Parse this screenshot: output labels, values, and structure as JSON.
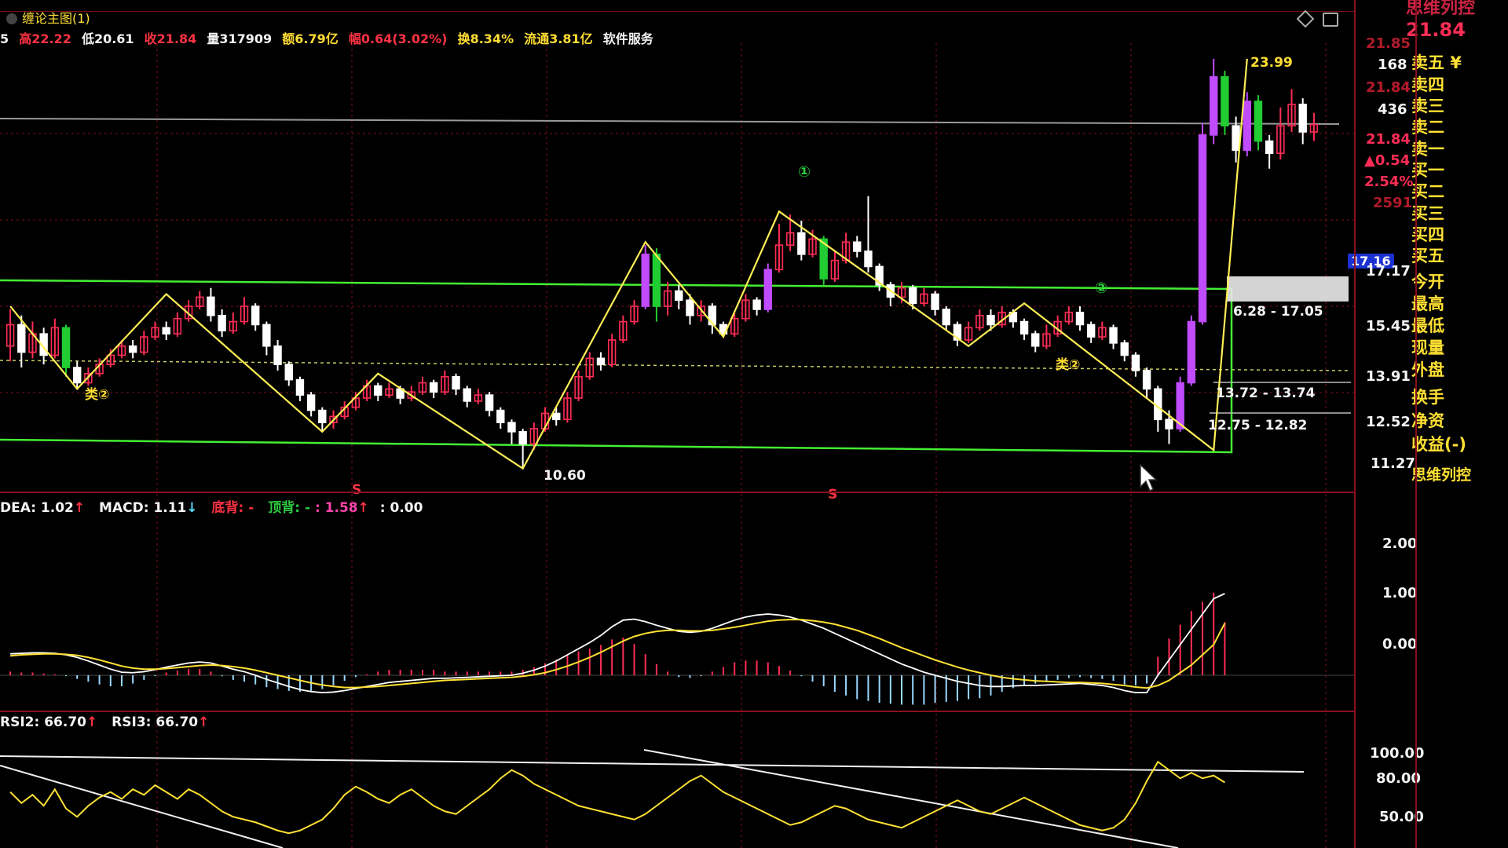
{
  "chart_title": "缠论主图(1)",
  "quote_bar": {
    "open_prefix": "5",
    "high": "高22.22",
    "low": "低20.61",
    "close": "收21.84",
    "volume": "量317909",
    "amount": "额6.79亿",
    "change": "幅0.64(3.02%)",
    "turnover": "换8.34%",
    "float_cap": "流通3.81亿",
    "industry": "软件服务"
  },
  "colors": {
    "bg": "#000000",
    "up": "#ff2d55",
    "down": "#ffffff",
    "big_up": "#c04bff",
    "big_down": "#22cc33",
    "zigzag": "#ffee55",
    "zone": "#44ee33",
    "grid": "#7a0f1a",
    "dif": "#ffffff",
    "dea": "#ffe033",
    "axis_text": "#f4f4f4"
  },
  "main_axis": {
    "ticks": [
      "21.85",
      "21.84",
      "17.17",
      "15.45",
      "13.91",
      "12.52",
      "11.27"
    ]
  },
  "main_labels": {
    "peak": "23.99",
    "low": "10.60",
    "c1": "①",
    "c2": "②",
    "bi2_a": "类②",
    "bi2_b": "类②",
    "range_a": "6.28 - 17.05",
    "range_b": "13.72 - 13.74",
    "range_c": "12.75 - 12.82",
    "s_marker": "S",
    "current_price_tag": "17.16"
  },
  "macd": {
    "legend_dea": "DEA: 1.02",
    "legend_macd": "MACD: 1.11",
    "legend_bottom": "底背: -",
    "legend_top": "顶背: -",
    "legend_tail": ": 1.58",
    "legend_zero": ": 0.00",
    "ticks": [
      "2.00",
      "1.00",
      "0.00"
    ]
  },
  "rsi": {
    "legend_rsi2": "RSI2: 66.70",
    "legend_rsi3": "RSI3: 66.70",
    "ticks": [
      "100.00",
      "80.00",
      "50.00"
    ]
  },
  "order_book": {
    "price": "21.84",
    "ask5_vol": "168",
    "ask_price_faded": "21.84",
    "ask3_vol": "436",
    "last": "21.84",
    "chg": "▲0.54",
    "pct": "2.54%",
    "vol": "2591",
    "rows": [
      "卖五 ¥",
      "卖四",
      "卖三",
      "卖二",
      "卖一",
      "买一",
      "买二",
      "买三",
      "买四",
      "买五",
      "今开",
      "最高",
      "最低",
      "现量",
      "外盘",
      "换手",
      "净资",
      "收益(-)",
      "思维列控"
    ],
    "title_fragment": "思维列控"
  },
  "chart_data": {
    "type": "candlestick",
    "title": "缠论主图(1)",
    "ylim": [
      10.0,
      24.5
    ],
    "candles": [
      [
        14.6,
        15.3,
        14.1,
        15.8
      ],
      [
        15.3,
        14.4,
        13.9,
        15.6
      ],
      [
        14.4,
        15.0,
        14.2,
        15.4
      ],
      [
        15.0,
        14.3,
        14.0,
        15.2
      ],
      [
        14.3,
        15.2,
        14.2,
        15.5
      ],
      [
        15.2,
        13.9,
        13.6,
        15.3
      ],
      [
        13.9,
        13.4,
        13.2,
        14.1
      ],
      [
        13.4,
        13.7,
        13.3,
        13.9
      ],
      [
        13.7,
        14.0,
        13.6,
        14.2
      ],
      [
        14.0,
        14.3,
        13.9,
        14.5
      ],
      [
        14.3,
        14.6,
        14.2,
        14.8
      ],
      [
        14.6,
        14.4,
        14.2,
        14.8
      ],
      [
        14.4,
        14.9,
        14.3,
        15.1
      ],
      [
        14.9,
        15.2,
        14.8,
        15.4
      ],
      [
        15.2,
        15.0,
        14.8,
        15.4
      ],
      [
        15.0,
        15.5,
        14.9,
        15.7
      ],
      [
        15.5,
        15.9,
        15.4,
        16.1
      ],
      [
        15.9,
        16.2,
        15.8,
        16.4
      ],
      [
        16.2,
        15.6,
        15.4,
        16.5
      ],
      [
        15.6,
        15.1,
        14.9,
        15.8
      ],
      [
        15.1,
        15.4,
        15.0,
        15.7
      ],
      [
        15.4,
        15.9,
        15.3,
        16.2
      ],
      [
        15.9,
        15.3,
        15.1,
        16.0
      ],
      [
        15.3,
        14.6,
        14.3,
        15.4
      ],
      [
        14.6,
        14.0,
        13.8,
        14.8
      ],
      [
        14.0,
        13.5,
        13.3,
        14.1
      ],
      [
        13.5,
        13.0,
        12.8,
        13.6
      ],
      [
        13.0,
        12.5,
        12.3,
        13.1
      ],
      [
        12.5,
        12.1,
        11.8,
        12.6
      ],
      [
        12.1,
        12.3,
        11.9,
        12.5
      ],
      [
        12.3,
        12.6,
        12.2,
        12.8
      ],
      [
        12.6,
        12.9,
        12.5,
        13.1
      ],
      [
        12.9,
        13.3,
        12.8,
        13.5
      ],
      [
        13.3,
        13.0,
        12.8,
        13.4
      ],
      [
        13.0,
        13.2,
        12.9,
        13.4
      ],
      [
        13.2,
        12.9,
        12.7,
        13.3
      ],
      [
        12.9,
        13.1,
        12.8,
        13.3
      ],
      [
        13.1,
        13.4,
        13.0,
        13.6
      ],
      [
        13.4,
        13.1,
        12.9,
        13.5
      ],
      [
        13.1,
        13.6,
        13.0,
        13.8
      ],
      [
        13.6,
        13.2,
        13.0,
        13.7
      ],
      [
        13.2,
        12.8,
        12.6,
        13.3
      ],
      [
        12.8,
        13.0,
        12.7,
        13.2
      ],
      [
        13.0,
        12.5,
        12.3,
        13.1
      ],
      [
        12.5,
        12.1,
        11.9,
        12.6
      ],
      [
        12.1,
        11.8,
        11.4,
        12.2
      ],
      [
        11.8,
        11.4,
        10.6,
        11.9
      ],
      [
        11.4,
        11.9,
        11.2,
        12.1
      ],
      [
        11.9,
        12.4,
        11.8,
        12.6
      ],
      [
        12.4,
        12.2,
        12.0,
        12.6
      ],
      [
        12.2,
        12.9,
        12.1,
        13.1
      ],
      [
        12.9,
        13.6,
        12.8,
        13.8
      ],
      [
        13.6,
        14.2,
        13.5,
        14.4
      ],
      [
        14.2,
        14.0,
        13.8,
        14.4
      ],
      [
        14.0,
        14.8,
        13.9,
        15.0
      ],
      [
        14.8,
        15.4,
        14.7,
        15.6
      ],
      [
        15.4,
        15.9,
        15.3,
        16.1
      ],
      [
        15.9,
        17.6,
        15.8,
        17.9
      ],
      [
        17.6,
        15.9,
        15.4,
        17.8
      ],
      [
        15.9,
        16.4,
        15.6,
        16.7
      ],
      [
        16.4,
        16.1,
        15.8,
        16.6
      ],
      [
        16.1,
        15.6,
        15.3,
        16.3
      ],
      [
        15.6,
        15.9,
        15.4,
        16.1
      ],
      [
        15.9,
        15.3,
        15.0,
        16.0
      ],
      [
        15.3,
        15.0,
        14.9,
        15.4
      ],
      [
        15.0,
        15.5,
        14.9,
        15.7
      ],
      [
        15.5,
        16.1,
        15.4,
        16.3
      ],
      [
        16.1,
        15.8,
        15.6,
        16.2
      ],
      [
        15.8,
        17.1,
        15.7,
        17.3
      ],
      [
        17.1,
        17.9,
        17.0,
        18.6
      ],
      [
        17.9,
        18.3,
        17.7,
        18.9
      ],
      [
        18.3,
        17.6,
        17.4,
        18.7
      ],
      [
        17.6,
        18.1,
        17.5,
        18.4
      ],
      [
        18.1,
        16.8,
        16.6,
        18.2
      ],
      [
        16.8,
        17.4,
        16.7,
        17.7
      ],
      [
        17.4,
        18.0,
        17.3,
        18.3
      ],
      [
        18.0,
        17.7,
        17.5,
        18.2
      ],
      [
        17.7,
        17.2,
        17.0,
        19.5
      ],
      [
        17.2,
        16.6,
        16.4,
        17.3
      ],
      [
        16.6,
        16.2,
        15.9,
        16.7
      ],
      [
        16.2,
        16.5,
        16.0,
        16.7
      ],
      [
        16.5,
        16.0,
        15.8,
        16.6
      ],
      [
        16.0,
        16.3,
        15.9,
        16.5
      ],
      [
        16.3,
        15.8,
        15.6,
        16.4
      ],
      [
        15.8,
        15.3,
        15.1,
        15.9
      ],
      [
        15.3,
        14.8,
        14.6,
        15.4
      ],
      [
        14.8,
        15.2,
        14.7,
        15.4
      ],
      [
        15.2,
        15.6,
        15.1,
        15.8
      ],
      [
        15.6,
        15.3,
        15.1,
        15.8
      ],
      [
        15.3,
        15.7,
        15.2,
        15.9
      ],
      [
        15.7,
        15.4,
        15.2,
        15.8
      ],
      [
        15.4,
        15.0,
        14.8,
        15.5
      ],
      [
        15.0,
        14.6,
        14.4,
        15.1
      ],
      [
        14.6,
        15.0,
        14.5,
        15.3
      ],
      [
        15.0,
        15.4,
        14.9,
        15.6
      ],
      [
        15.4,
        15.7,
        15.3,
        15.9
      ],
      [
        15.7,
        15.3,
        15.1,
        15.9
      ],
      [
        15.3,
        14.9,
        14.7,
        15.4
      ],
      [
        14.9,
        15.2,
        14.8,
        15.4
      ],
      [
        15.2,
        14.7,
        14.5,
        15.3
      ],
      [
        14.7,
        14.3,
        14.1,
        14.8
      ],
      [
        14.3,
        13.8,
        13.6,
        14.4
      ],
      [
        13.8,
        13.2,
        12.9,
        13.9
      ],
      [
        13.2,
        12.2,
        11.8,
        13.3
      ],
      [
        12.2,
        11.9,
        11.4,
        12.5
      ],
      [
        11.9,
        13.4,
        11.8,
        13.6
      ],
      [
        13.4,
        15.4,
        13.3,
        15.6
      ],
      [
        15.4,
        21.5,
        15.3,
        21.9
      ],
      [
        21.5,
        23.4,
        21.2,
        23.99
      ],
      [
        23.4,
        21.8,
        21.5,
        23.6
      ],
      [
        21.8,
        21.0,
        20.6,
        22.1
      ],
      [
        21.0,
        22.6,
        20.8,
        22.9
      ],
      [
        22.6,
        21.3,
        21.0,
        22.8
      ],
      [
        21.3,
        20.9,
        20.4,
        21.5
      ],
      [
        20.9,
        21.8,
        20.7,
        22.4
      ],
      [
        21.8,
        22.5,
        21.6,
        23.0
      ],
      [
        22.5,
        21.6,
        21.2,
        22.7
      ],
      [
        21.6,
        21.84,
        21.3,
        22.22
      ]
    ],
    "zigzag_points": [
      [
        0,
        15.9
      ],
      [
        6,
        13.2
      ],
      [
        14,
        16.3
      ],
      [
        28,
        11.8
      ],
      [
        33,
        13.7
      ],
      [
        46,
        10.6
      ],
      [
        57,
        18.0
      ],
      [
        64,
        14.9
      ],
      [
        69,
        19.0
      ],
      [
        86,
        14.6
      ],
      [
        91,
        16.0
      ],
      [
        108,
        11.2
      ],
      [
        111,
        23.99
      ]
    ],
    "macd_dif": [
      0.42,
      0.43,
      0.44,
      0.44,
      0.43,
      0.4,
      0.35,
      0.28,
      0.2,
      0.12,
      0.06,
      0.05,
      0.07,
      0.11,
      0.16,
      0.2,
      0.24,
      0.26,
      0.24,
      0.18,
      0.12,
      0.07,
      0.0,
      -0.08,
      -0.15,
      -0.22,
      -0.28,
      -0.32,
      -0.34,
      -0.33,
      -0.3,
      -0.26,
      -0.22,
      -0.18,
      -0.14,
      -0.12,
      -0.1,
      -0.08,
      -0.06,
      -0.06,
      -0.05,
      -0.04,
      -0.03,
      -0.02,
      -0.01,
      0.0,
      0.04,
      0.1,
      0.18,
      0.28,
      0.4,
      0.52,
      0.64,
      0.78,
      0.95,
      1.08,
      1.1,
      1.05,
      0.98,
      0.92,
      0.86,
      0.84,
      0.86,
      0.92,
      1.0,
      1.08,
      1.14,
      1.18,
      1.2,
      1.18,
      1.14,
      1.08,
      1.0,
      0.92,
      0.82,
      0.72,
      0.62,
      0.52,
      0.42,
      0.32,
      0.22,
      0.14,
      0.06,
      0.0,
      -0.06,
      -0.12,
      -0.16,
      -0.2,
      -0.22,
      -0.22,
      -0.21,
      -0.2,
      -0.2,
      -0.19,
      -0.18,
      -0.17,
      -0.16,
      -0.18,
      -0.2,
      -0.24,
      -0.3,
      -0.34,
      -0.34,
      0.0,
      0.3,
      0.6,
      0.9,
      1.2,
      1.5,
      1.6
    ],
    "macd_dea": [
      0.38,
      0.4,
      0.41,
      0.42,
      0.42,
      0.41,
      0.39,
      0.35,
      0.3,
      0.24,
      0.18,
      0.14,
      0.12,
      0.12,
      0.13,
      0.15,
      0.17,
      0.19,
      0.2,
      0.19,
      0.17,
      0.14,
      0.1,
      0.05,
      0.0,
      -0.05,
      -0.1,
      -0.15,
      -0.19,
      -0.22,
      -0.24,
      -0.24,
      -0.23,
      -0.22,
      -0.2,
      -0.18,
      -0.16,
      -0.14,
      -0.12,
      -0.1,
      -0.09,
      -0.08,
      -0.07,
      -0.06,
      -0.05,
      -0.04,
      -0.02,
      0.01,
      0.05,
      0.11,
      0.18,
      0.26,
      0.35,
      0.45,
      0.56,
      0.67,
      0.76,
      0.82,
      0.86,
      0.88,
      0.88,
      0.87,
      0.87,
      0.88,
      0.91,
      0.94,
      0.98,
      1.02,
      1.06,
      1.08,
      1.09,
      1.09,
      1.07,
      1.04,
      1.0,
      0.94,
      0.88,
      0.8,
      0.72,
      0.63,
      0.54,
      0.46,
      0.38,
      0.3,
      0.23,
      0.16,
      0.1,
      0.05,
      0.0,
      -0.04,
      -0.07,
      -0.09,
      -0.11,
      -0.12,
      -0.13,
      -0.14,
      -0.14,
      -0.15,
      -0.16,
      -0.18,
      -0.2,
      -0.23,
      -0.25,
      -0.2,
      -0.1,
      0.05,
      0.2,
      0.4,
      0.6,
      1.02
    ],
    "rsi": [
      60,
      52,
      58,
      50,
      62,
      48,
      42,
      50,
      56,
      60,
      55,
      62,
      58,
      65,
      60,
      55,
      62,
      58,
      52,
      46,
      42,
      40,
      38,
      35,
      32,
      30,
      32,
      36,
      40,
      48,
      58,
      64,
      60,
      55,
      52,
      58,
      62,
      56,
      50,
      46,
      44,
      50,
      56,
      62,
      70,
      76,
      72,
      66,
      62,
      58,
      54,
      50,
      48,
      46,
      44,
      42,
      40,
      44,
      50,
      56,
      62,
      68,
      72,
      66,
      60,
      56,
      52,
      48,
      44,
      40,
      36,
      38,
      42,
      46,
      50,
      48,
      44,
      40,
      38,
      36,
      34,
      38,
      42,
      46,
      50,
      54,
      50,
      46,
      44,
      48,
      52,
      56,
      52,
      48,
      44,
      40,
      36,
      34,
      32,
      34,
      40,
      52,
      68,
      82,
      76,
      70,
      74,
      70,
      72,
      67
    ]
  }
}
